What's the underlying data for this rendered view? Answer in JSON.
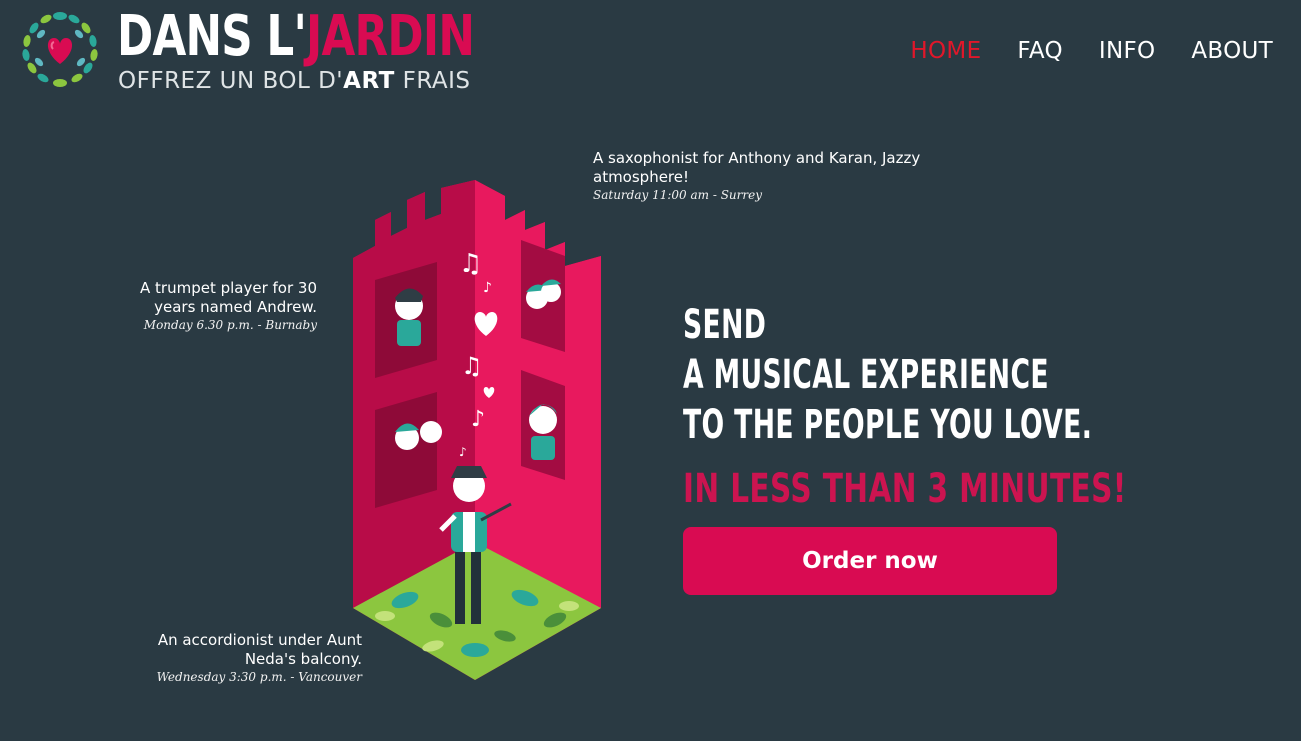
{
  "header": {
    "logo": {
      "title_part1": "DANS L'",
      "title_part2": "JARDIN",
      "tagline_part1": "OFFREZ UN BOL D'",
      "tagline_bold": "ART",
      "tagline_part2": " FRAIS",
      "emblem_icon": "heart-wreath-icon"
    },
    "nav": [
      {
        "label": "HOME",
        "active": true
      },
      {
        "label": "FAQ",
        "active": false
      },
      {
        "label": "INFO",
        "active": false
      },
      {
        "label": "ABOUT",
        "active": false
      }
    ]
  },
  "captions": {
    "saxophonist": {
      "text": "A saxophonist for Anthony and Karan, Jazzy atmosphere!",
      "meta": "Saturday 11:00 am - Surrey"
    },
    "trumpet": {
      "text": "A trumpet player for 30 years named Andrew.",
      "meta": "Monday 6.30 p.m. - Burnaby"
    },
    "accordion": {
      "text": "An accordionist under Aunt Neda's balcony.",
      "meta": "Wednesday 3:30 p.m. - Vancouver"
    }
  },
  "hero": {
    "line1": "SEND",
    "line2": "A MUSICAL EXPERIENCE",
    "line3": "TO THE PEOPLE YOU LOVE.",
    "accent": "IN LESS THAN 3 MINUTES!",
    "cta_label": "Order now"
  },
  "colors": {
    "background": "#2a3a43",
    "accent_pink": "#d90b52",
    "nav_active": "#e0172a",
    "teal": "#2aa89a",
    "leaf_green": "#8cc63f"
  }
}
